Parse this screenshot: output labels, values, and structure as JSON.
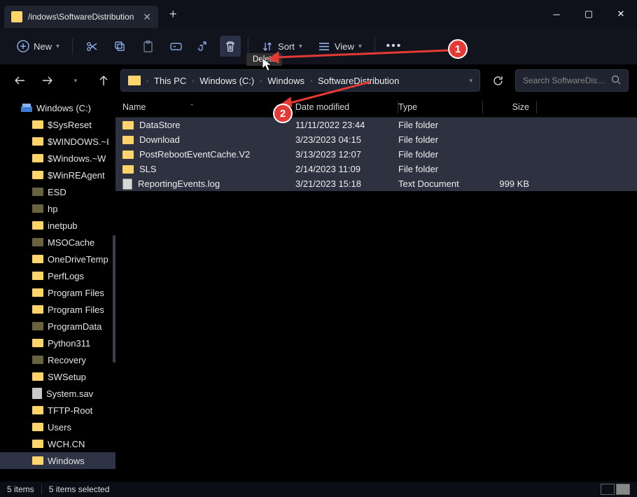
{
  "tab": {
    "title": "/indows\\SoftwareDistribution"
  },
  "tooltip": {
    "delete": "Delete"
  },
  "toolbar": {
    "new": "New",
    "sort": "Sort",
    "view": "View"
  },
  "breadcrumb": {
    "items": [
      "This PC",
      "Windows (C:)",
      "Windows",
      "SoftwareDistribution"
    ]
  },
  "search": {
    "placeholder": "Search SoftwareDistri…"
  },
  "columns": {
    "name": "Name",
    "date": "Date modified",
    "type": "Type",
    "size": "Size"
  },
  "files": [
    {
      "name": "DataStore",
      "date": "11/11/2022 23:44",
      "type": "File folder",
      "size": "",
      "icon": "folder"
    },
    {
      "name": "Download",
      "date": "3/23/2023 04:15",
      "type": "File folder",
      "size": "",
      "icon": "folder"
    },
    {
      "name": "PostRebootEventCache.V2",
      "date": "3/13/2023 12:07",
      "type": "File folder",
      "size": "",
      "icon": "folder"
    },
    {
      "name": "SLS",
      "date": "2/14/2023 11:09",
      "type": "File folder",
      "size": "",
      "icon": "folder"
    },
    {
      "name": "ReportingEvents.log",
      "date": "3/21/2023 15:18",
      "type": "Text Document",
      "size": "999 KB",
      "icon": "file"
    }
  ],
  "tree": {
    "root": "Windows (C:)",
    "items": [
      {
        "label": "$SysReset",
        "dark": false
      },
      {
        "label": "$WINDOWS.~I",
        "dark": false
      },
      {
        "label": "$Windows.~W",
        "dark": false
      },
      {
        "label": "$WinREAgent",
        "dark": false
      },
      {
        "label": "ESD",
        "dark": true
      },
      {
        "label": "hp",
        "dark": true
      },
      {
        "label": "inetpub",
        "dark": false
      },
      {
        "label": "MSOCache",
        "dark": true
      },
      {
        "label": "OneDriveTemp",
        "dark": false
      },
      {
        "label": "PerfLogs",
        "dark": false
      },
      {
        "label": "Program Files",
        "dark": false
      },
      {
        "label": "Program Files",
        "dark": false
      },
      {
        "label": "ProgramData",
        "dark": true
      },
      {
        "label": "Python311",
        "dark": false
      },
      {
        "label": "Recovery",
        "dark": true
      },
      {
        "label": "SWSetup",
        "dark": false
      },
      {
        "label": "System.sav",
        "dark": false,
        "fileicon": true
      },
      {
        "label": "TFTP-Root",
        "dark": false
      },
      {
        "label": "Users",
        "dark": false
      },
      {
        "label": "WCH.CN",
        "dark": false
      },
      {
        "label": "Windows",
        "dark": false,
        "selected": true
      }
    ]
  },
  "status": {
    "count": "5 items",
    "selected": "5 items selected"
  },
  "annotations": {
    "badge1": "1",
    "badge2": "2"
  }
}
